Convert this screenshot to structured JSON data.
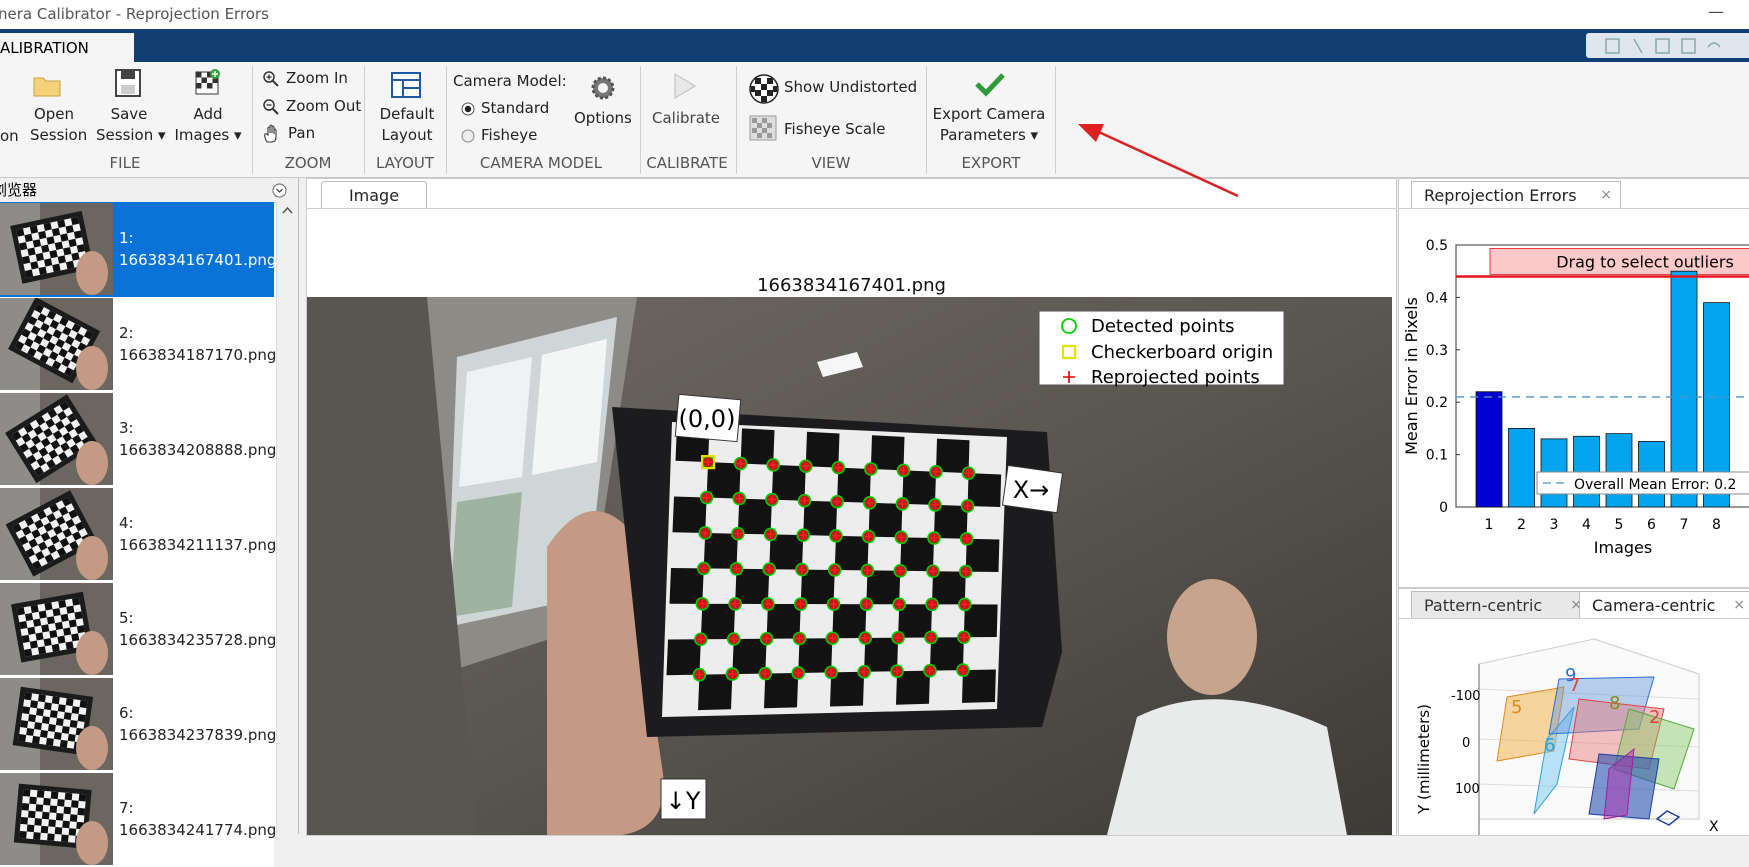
{
  "window": {
    "title": "nera Calibrator - Reprojection Errors",
    "minimize": "—"
  },
  "ribbon": {
    "tab": "ALIBRATION",
    "file": {
      "new_fragment": "on",
      "open_session": [
        "Open",
        "Session"
      ],
      "save_session": [
        "Save",
        "Session ▾"
      ],
      "add_images": [
        "Add",
        "Images ▾"
      ],
      "group": "FILE"
    },
    "zoom": {
      "zoom_in": "Zoom In",
      "zoom_out": "Zoom Out",
      "pan": "Pan",
      "group": "ZOOM"
    },
    "layout": {
      "default_layout": [
        "Default",
        "Layout"
      ],
      "group": "LAYOUT"
    },
    "camera_model": {
      "label": "Camera Model:",
      "standard": "Standard",
      "fisheye": "Fisheye",
      "options": "Options",
      "selected": "Standard",
      "group": "CAMERA MODEL"
    },
    "calibrate": {
      "label": "Calibrate",
      "group": "CALIBRATE"
    },
    "view": {
      "show_undistorted": "Show Undistorted",
      "fisheye_scale": "Fisheye Scale",
      "group": "VIEW"
    },
    "export": {
      "label": [
        "Export Camera",
        "Parameters ▾"
      ],
      "group": "EXPORT"
    }
  },
  "browser": {
    "title": "浏览器",
    "items": [
      {
        "index": "1:",
        "file": "1663834167401.png",
        "selected": true
      },
      {
        "index": "2:",
        "file": "1663834187170.png",
        "selected": false
      },
      {
        "index": "3:",
        "file": "1663834208888.png",
        "selected": false
      },
      {
        "index": "4:",
        "file": "1663834211137.png",
        "selected": false
      },
      {
        "index": "5:",
        "file": "1663834235728.png",
        "selected": false
      },
      {
        "index": "6:",
        "file": "1663834237839.png",
        "selected": false
      },
      {
        "index": "7:",
        "file": "1663834241774.png",
        "selected": false
      }
    ]
  },
  "image_panel": {
    "tab": "Image",
    "image_title": "1663834167401.png",
    "origin_label": "(0,0)",
    "x_label": "X→",
    "y_label": "↓Y",
    "legend": [
      "Detected points",
      "Checkerboard origin",
      "Reprojected points"
    ]
  },
  "reprojection": {
    "tab": "Reprojection Errors",
    "close": "×",
    "banner": "Drag to select outliers",
    "overall": "Overall Mean Error: 0.2",
    "chart_data": {
      "type": "bar",
      "categories": [
        "1",
        "2",
        "3",
        "4",
        "5",
        "6",
        "7",
        "8"
      ],
      "values": [
        0.22,
        0.15,
        0.13,
        0.135,
        0.14,
        0.125,
        0.45,
        0.39
      ],
      "ylim": [
        0,
        0.5
      ],
      "yticks": [
        "0",
        "0.1",
        "0.2",
        "0.3",
        "0.4",
        "0.5"
      ],
      "xlabel": "Images",
      "ylabel": "Mean Error in Pixels",
      "overall_mean": 0.21,
      "threshold": 0.44,
      "selected_index": 0,
      "colors": {
        "bar": "#00a5ee",
        "selected": "#0000d0",
        "threshold": "#e8141e",
        "banner": "#fbc9c9"
      }
    }
  },
  "poses": {
    "tabs": [
      "Pattern-centric",
      "Camera-centric"
    ],
    "active": "Camera-centric",
    "close": "×",
    "ylabel": "Y (millimeters)",
    "yticks": [
      "-100",
      "0",
      "100"
    ],
    "xaxis": "X",
    "board_labels": [
      "9",
      "5",
      "7",
      "8",
      "6",
      "2"
    ]
  }
}
